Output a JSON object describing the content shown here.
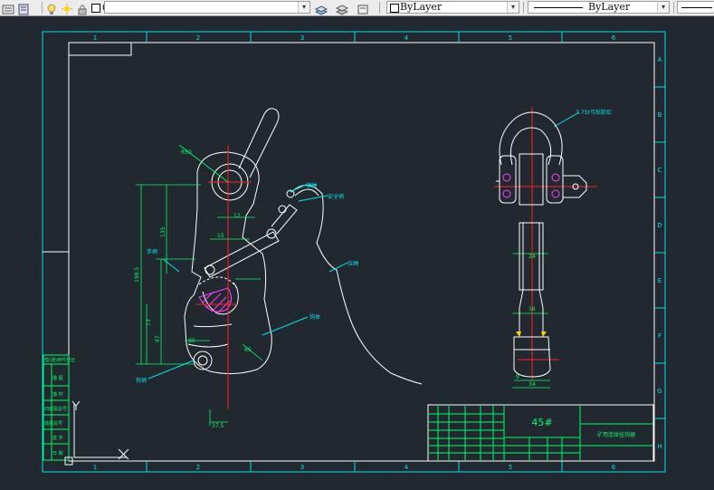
{
  "toolbar": {
    "layer_current": "0",
    "color_combo": "ByLayer",
    "linetype_combo": "ByLayer"
  },
  "drawing": {
    "border_columns": [
      "1",
      "2",
      "3",
      "4",
      "5",
      "6"
    ],
    "border_rows": [
      "A",
      "B",
      "C",
      "D",
      "E",
      "F",
      "G",
      "H"
    ],
    "title_block": {
      "material": "45#",
      "drawing_name": "矿用连续挂钩器"
    },
    "left_stamp_rows": [
      "借(通)用件登记",
      "描 图",
      "描 校",
      "旧底图总号",
      "底图总号",
      "签 字",
      "日 期"
    ],
    "part_labels": {
      "shackle": "3.75t弓形卸扣",
      "pin": "销轴",
      "safety_pin": "安全销",
      "cable": "拉绳",
      "hook_body": "钩体",
      "hook_pin": "钩销",
      "handle": "手柄"
    },
    "dimensions": {
      "d_r50": "R50",
      "d_12": "12",
      "d_15": "15",
      "d_73": "73",
      "d_97": "97",
      "d_1985": "198.5",
      "d_24": "24",
      "d_16": "16",
      "d_34": "34",
      "d_9": "9",
      "d_37": "37.5",
      "d_135": "135",
      "d_85": "85",
      "d_65": "65"
    }
  },
  "colors": {
    "background": "#212830",
    "border": "#00e5e5",
    "geometry": "#ffffff",
    "dims": "#00ff66",
    "centerline": "#ff2020",
    "hatch": "#ff40ff",
    "leader": "#00e5e5",
    "title_text": "#00ff66"
  }
}
